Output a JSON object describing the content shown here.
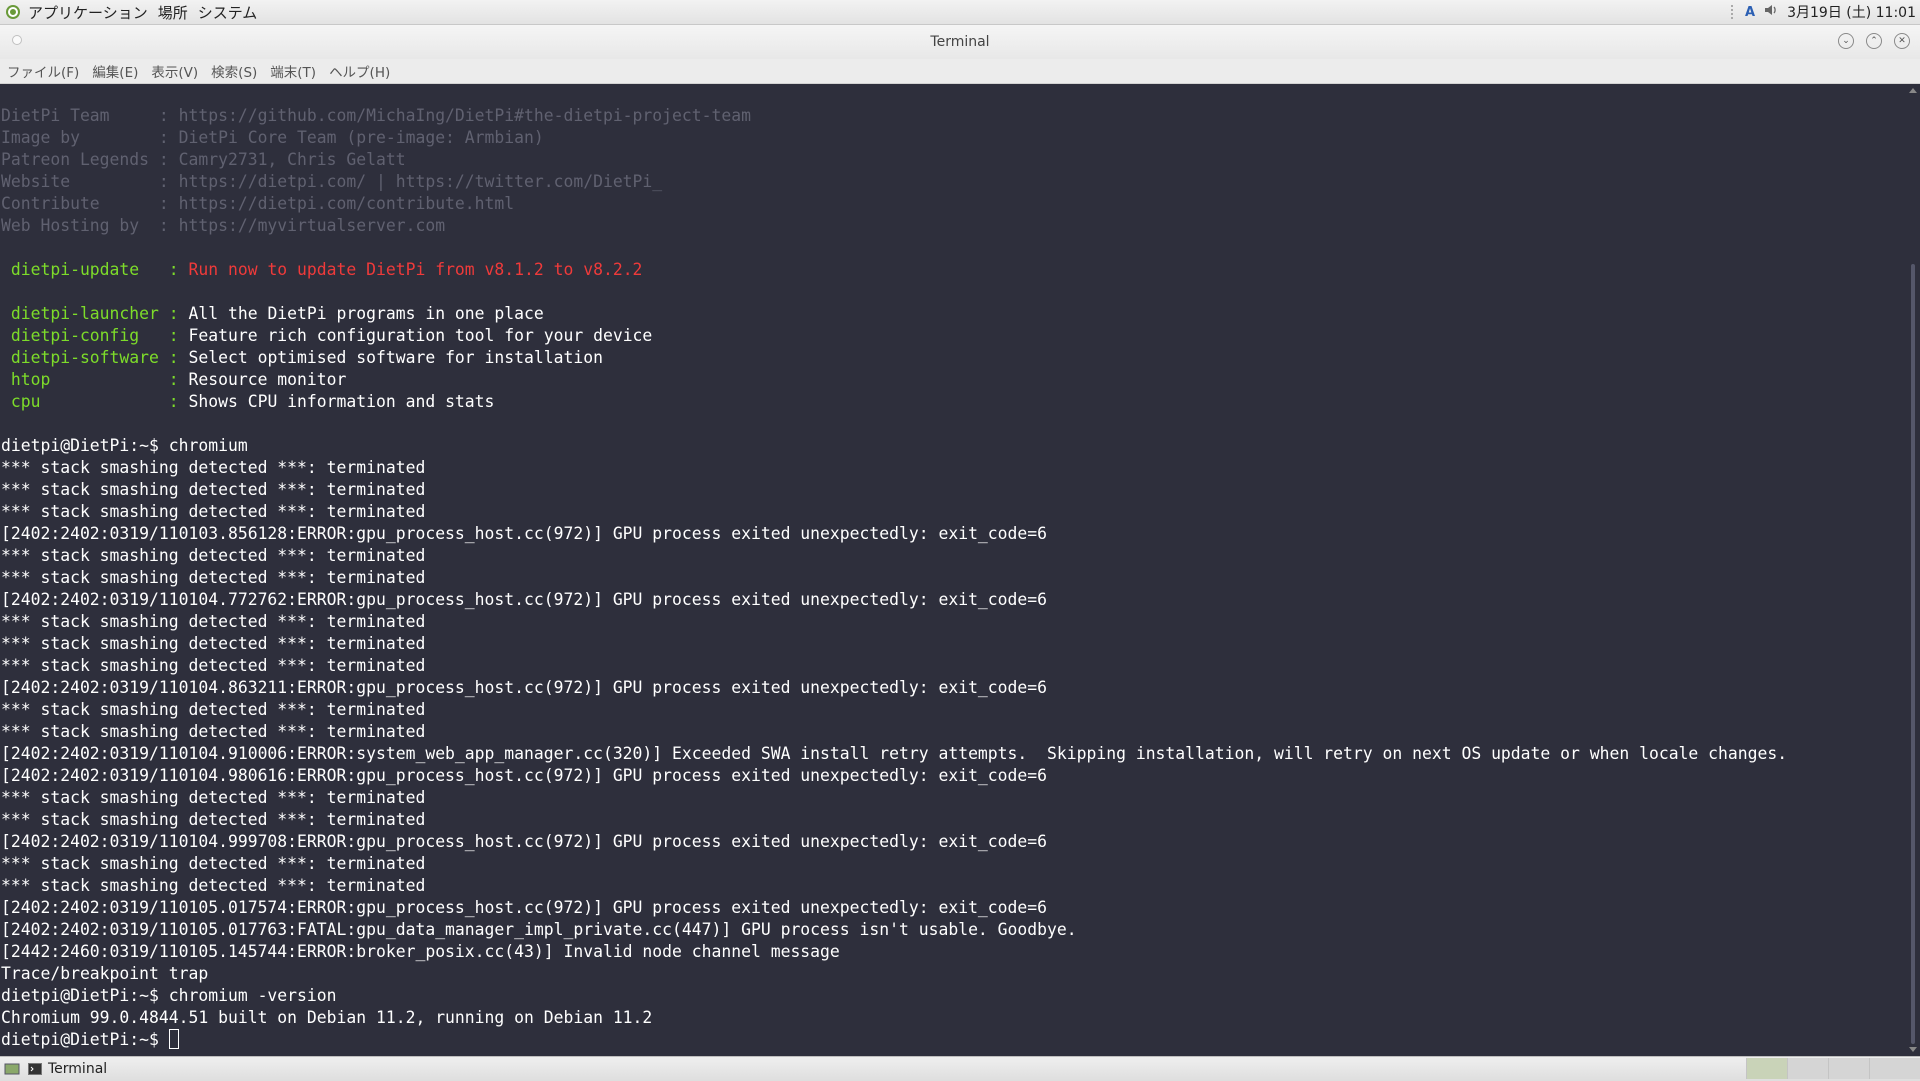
{
  "top_panel": {
    "menus": [
      "アプリケーション",
      "場所",
      "システム"
    ],
    "input_indicator": "A",
    "clock": "3月19日 (土) 11:01"
  },
  "window": {
    "title": "Terminal"
  },
  "menubar": [
    "ファイル(F)",
    "編集(E)",
    "表示(V)",
    "検索(S)",
    "端末(T)",
    "ヘルプ(H)"
  ],
  "terminal": {
    "lines": [
      [
        {
          "t": "DietPi Team     : https://github.com/MichaIng/DietPi#the-dietpi-project-team",
          "c": "dim"
        }
      ],
      [
        {
          "t": "Image by        : DietPi Core Team (pre-image: Armbian)",
          "c": "dim"
        }
      ],
      [
        {
          "t": "Patreon Legends : Camry2731, Chris Gelatt",
          "c": "dim"
        }
      ],
      [
        {
          "t": "Website         : https://dietpi.com/ | https://twitter.com/DietPi_",
          "c": "dim"
        }
      ],
      [
        {
          "t": "Contribute      : https://dietpi.com/contribute.html",
          "c": "dim"
        }
      ],
      [
        {
          "t": "Web Hosting by  : https://myvirtualserver.com",
          "c": "dim"
        }
      ],
      [],
      [
        {
          "t": " dietpi-update   : ",
          "c": "green"
        },
        {
          "t": "Run now to update DietPi from v8.1.2 to v8.2.2",
          "c": "red"
        }
      ],
      [],
      [
        {
          "t": " dietpi-launcher : ",
          "c": "green"
        },
        {
          "t": "All the DietPi programs in one place",
          "c": "white"
        }
      ],
      [
        {
          "t": " dietpi-config   : ",
          "c": "green"
        },
        {
          "t": "Feature rich configuration tool for your device",
          "c": "white"
        }
      ],
      [
        {
          "t": " dietpi-software : ",
          "c": "green"
        },
        {
          "t": "Select optimised software for installation",
          "c": "white"
        }
      ],
      [
        {
          "t": " htop            : ",
          "c": "green"
        },
        {
          "t": "Resource monitor",
          "c": "white"
        }
      ],
      [
        {
          "t": " cpu             : ",
          "c": "green"
        },
        {
          "t": "Shows CPU information and stats",
          "c": "white"
        }
      ],
      [],
      [
        {
          "t": "dietpi@DietPi:~$ chromium",
          "c": "white"
        }
      ],
      [
        {
          "t": "*** stack smashing detected ***: terminated",
          "c": "white"
        }
      ],
      [
        {
          "t": "*** stack smashing detected ***: terminated",
          "c": "white"
        }
      ],
      [
        {
          "t": "*** stack smashing detected ***: terminated",
          "c": "white"
        }
      ],
      [
        {
          "t": "[2402:2402:0319/110103.856128:ERROR:gpu_process_host.cc(972)] GPU process exited unexpectedly: exit_code=6",
          "c": "white"
        }
      ],
      [
        {
          "t": "*** stack smashing detected ***: terminated",
          "c": "white"
        }
      ],
      [
        {
          "t": "*** stack smashing detected ***: terminated",
          "c": "white"
        }
      ],
      [
        {
          "t": "[2402:2402:0319/110104.772762:ERROR:gpu_process_host.cc(972)] GPU process exited unexpectedly: exit_code=6",
          "c": "white"
        }
      ],
      [
        {
          "t": "*** stack smashing detected ***: terminated",
          "c": "white"
        }
      ],
      [
        {
          "t": "*** stack smashing detected ***: terminated",
          "c": "white"
        }
      ],
      [
        {
          "t": "*** stack smashing detected ***: terminated",
          "c": "white"
        }
      ],
      [
        {
          "t": "[2402:2402:0319/110104.863211:ERROR:gpu_process_host.cc(972)] GPU process exited unexpectedly: exit_code=6",
          "c": "white"
        }
      ],
      [
        {
          "t": "*** stack smashing detected ***: terminated",
          "c": "white"
        }
      ],
      [
        {
          "t": "*** stack smashing detected ***: terminated",
          "c": "white"
        }
      ],
      [
        {
          "t": "[2402:2402:0319/110104.910006:ERROR:system_web_app_manager.cc(320)] Exceeded SWA install retry attempts.  Skipping installation, will retry on next OS update or when locale changes.",
          "c": "white"
        }
      ],
      [
        {
          "t": "[2402:2402:0319/110104.980616:ERROR:gpu_process_host.cc(972)] GPU process exited unexpectedly: exit_code=6",
          "c": "white"
        }
      ],
      [
        {
          "t": "*** stack smashing detected ***: terminated",
          "c": "white"
        }
      ],
      [
        {
          "t": "*** stack smashing detected ***: terminated",
          "c": "white"
        }
      ],
      [
        {
          "t": "[2402:2402:0319/110104.999708:ERROR:gpu_process_host.cc(972)] GPU process exited unexpectedly: exit_code=6",
          "c": "white"
        }
      ],
      [
        {
          "t": "*** stack smashing detected ***: terminated",
          "c": "white"
        }
      ],
      [
        {
          "t": "*** stack smashing detected ***: terminated",
          "c": "white"
        }
      ],
      [
        {
          "t": "[2402:2402:0319/110105.017574:ERROR:gpu_process_host.cc(972)] GPU process exited unexpectedly: exit_code=6",
          "c": "white"
        }
      ],
      [
        {
          "t": "[2402:2402:0319/110105.017763:FATAL:gpu_data_manager_impl_private.cc(447)] GPU process isn't usable. Goodbye.",
          "c": "white"
        }
      ],
      [
        {
          "t": "[2442:2460:0319/110105.145744:ERROR:broker_posix.cc(43)] Invalid node channel message",
          "c": "white"
        }
      ],
      [
        {
          "t": "Trace/breakpoint trap",
          "c": "white"
        }
      ],
      [
        {
          "t": "dietpi@DietPi:~$ chromium -version",
          "c": "white"
        }
      ],
      [
        {
          "t": "Chromium 99.0.4844.51 built on Debian 11.2, running on Debian 11.2",
          "c": "white"
        }
      ]
    ],
    "prompt": "dietpi@DietPi:~$ "
  },
  "taskbar": {
    "task_label": "Terminal"
  },
  "colors": {
    "background": "#2e2f3c",
    "green": "#7ddc2a",
    "red": "#ef3a3a",
    "dim": "#606170"
  },
  "icons": [
    "mate-logo-icon",
    "keyboard-indicator-icon",
    "volume-icon",
    "terminal-icon",
    "show-desktop-icon"
  ]
}
